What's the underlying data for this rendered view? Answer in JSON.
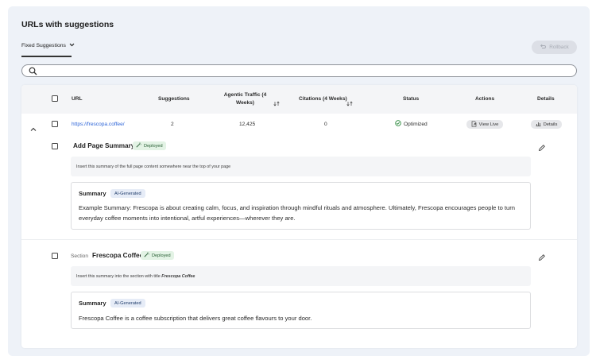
{
  "page": {
    "title": "URLs with suggestions",
    "filter_label": "Fixed Suggestions",
    "rollback_label": "Rollback",
    "search_placeholder": ""
  },
  "table": {
    "headers": {
      "url": "URL",
      "suggestions": "Suggestions",
      "traffic_line1": "Agentic Traffic (4",
      "traffic_line2": "Weeks)",
      "citations": "Citations (4 Weeks)",
      "status": "Status",
      "actions": "Actions",
      "details": "Details"
    },
    "rows": [
      {
        "url": "https://frescopa.coffee/",
        "suggestions": "2",
        "traffic": "12,425",
        "citations": "0",
        "status": "Optimized",
        "view_live_label": "View Live",
        "details_label": "Details"
      }
    ]
  },
  "suggestions": [
    {
      "prefix": "",
      "title": "Add Page Summary",
      "badge": "Deployed",
      "instruction": "Insert this summary of the full page content somewhere near the top of your page",
      "instruction_em": "",
      "summary_title": "Summary",
      "summary_badge": "AI-Generated",
      "summary_text": "Example Summary: Frescopa is about creating calm, focus, and inspiration through mindful rituals and atmosphere. Ultimately, Frescopa encourages people to turn everyday coffee moments into intentional, artful experiences—wherever they are."
    },
    {
      "prefix": "Section",
      "title": "Frescopa Coffee",
      "badge": "Deployed",
      "instruction": "Insert this summary into the section with title ",
      "instruction_em": "Frescopa Coffee",
      "summary_title": "Summary",
      "summary_badge": "AI-Generated",
      "summary_text": "Frescopa Coffee is a coffee subscription that delivers great coffee flavours to your door."
    }
  ],
  "colors": {
    "link": "#2c64d8",
    "deployed_bg": "#e3f3e5",
    "ai_badge_bg": "#e6ecf7",
    "status_ok": "#2d8a3e"
  }
}
